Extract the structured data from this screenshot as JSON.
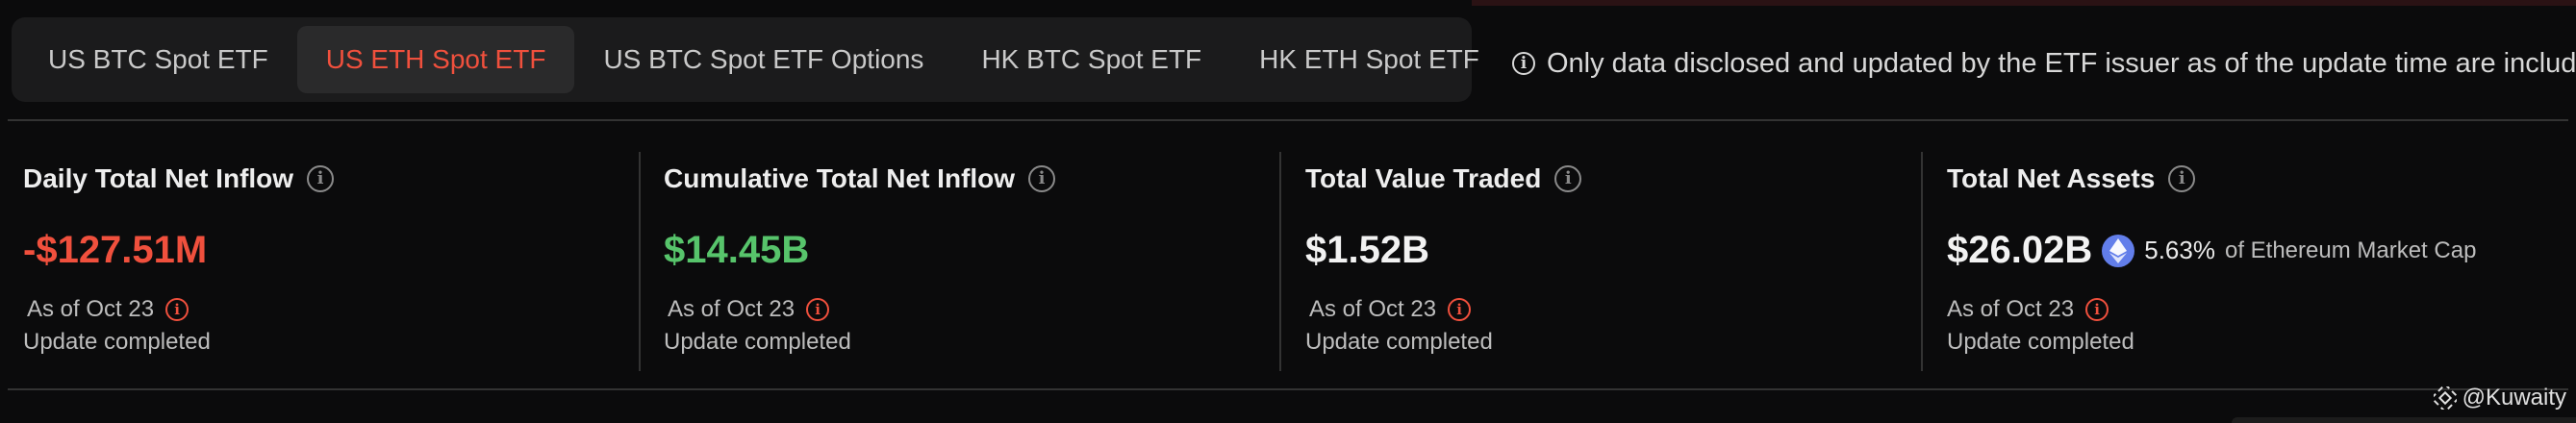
{
  "tabs": [
    {
      "label": "US BTC Spot ETF",
      "active": false
    },
    {
      "label": "US ETH Spot ETF",
      "active": true
    },
    {
      "label": "US BTC Spot ETF Options",
      "active": false
    },
    {
      "label": "HK BTC Spot ETF",
      "active": false
    },
    {
      "label": "HK ETH Spot ETF",
      "active": false
    }
  ],
  "notice": "Only data disclosed and updated by the ETF issuer as of the update time are included.",
  "cards": [
    {
      "title": "Daily Total Net Inflow",
      "value": "-$127.51M",
      "as_of": "As of Oct 23",
      "status": "Update completed"
    },
    {
      "title": "Cumulative Total Net Inflow",
      "value": "$14.45B",
      "as_of": "As of Oct 23",
      "status": "Update completed"
    },
    {
      "title": "Total Value Traded",
      "value": "$1.52B",
      "as_of": "As of Oct 23",
      "status": "Update completed"
    },
    {
      "title": "Total Net Assets",
      "value": "$26.02B",
      "percent": "5.63%",
      "percent_label": "of Ethereum Market Cap",
      "as_of": "As of Oct 23",
      "status": "Update completed"
    }
  ],
  "watermark": "@Kuwaity",
  "colors": {
    "accent": "#f0503d",
    "negative": "#f0503d",
    "positive": "#57c46b",
    "eth": "#627eea"
  },
  "icons": {
    "info": "info-circle-icon",
    "eth": "ethereum-icon",
    "watermark": "binance-logo-icon"
  }
}
